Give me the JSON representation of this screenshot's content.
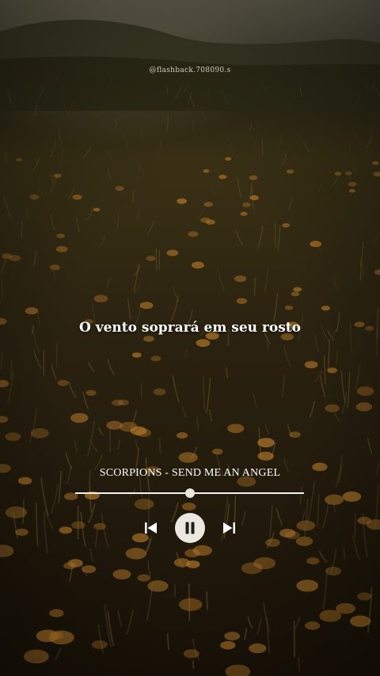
{
  "watermark": "@flashback.708090.s",
  "lyric": "O vento soprará em seu rosto",
  "player": {
    "song": "SCORPIONS - SEND ME AN ANGEL",
    "progress": 0.5,
    "state": "playing",
    "icons": {
      "previous": "skip-previous-icon",
      "pause": "pause-icon",
      "next": "skip-next-icon"
    }
  },
  "colors": {
    "text": "#ffffff",
    "control": "#ebe8e2",
    "field": "#2b2210",
    "flower": "#b77a2a"
  }
}
